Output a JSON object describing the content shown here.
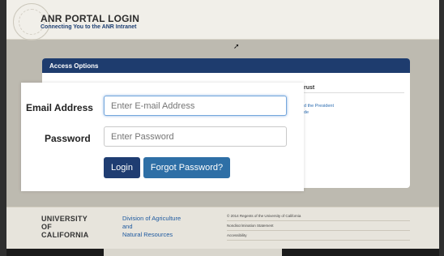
{
  "header": {
    "title": "ANR PORTAL LOGIN",
    "subtitle": "Connecting You to the ANR Intranet"
  },
  "access_panel": {
    "heading": "Access Options",
    "side_heading": "rust",
    "side_link_1": "d the President",
    "side_link_2": "de"
  },
  "login": {
    "email_label": "Email Address",
    "email_placeholder": "Enter E-mail Address",
    "email_value": "",
    "password_label": "Password",
    "password_placeholder": "Enter Password",
    "password_value": "",
    "login_button": "Login",
    "forgot_button": "Forgot Password?"
  },
  "footer": {
    "university_lines": [
      "UNIVERSITY",
      "OF",
      "CALIFORNIA"
    ],
    "division_lines": [
      "Division of Agriculture",
      "and",
      "Natural Resources"
    ],
    "links": [
      "© 2014 Regents of the University of California",
      "Nondiscrimination Statement",
      "Accessibility"
    ]
  },
  "colors": {
    "brand_navy": "#1e3c6e",
    "login_button": "#1f3d72",
    "forgot_button": "#2e6fa6",
    "focus_ring": "#75a7dc"
  },
  "icons": {
    "seal": "university-seal",
    "cursor": "mouse-pointer"
  }
}
